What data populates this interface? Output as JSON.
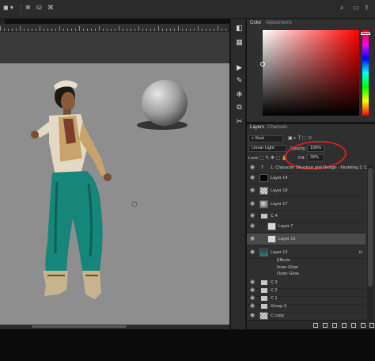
{
  "options_bar": {
    "icons": [
      "brush-size-icon",
      "gear-icon",
      "brush-settings-icon",
      "blend-icon"
    ]
  },
  "color_panel": {
    "tabs": [
      "Color",
      "Adjustments"
    ],
    "accent": "#ff0000"
  },
  "layers_panel": {
    "tabs": [
      "Layers",
      "Channels"
    ],
    "kind_label": "Kind",
    "blend_mode": "Linear Light",
    "opacity_label": "Opacity:",
    "opacity_value": "100%",
    "lock_label": "Lock:",
    "fill_label": "Fill:",
    "fill_value": "39%",
    "layers": [
      {
        "name": "1. Character Structure and Design - Modeling 3. C",
        "type": "text"
      },
      {
        "name": "Layer 14",
        "type": "black"
      },
      {
        "name": "Layer 18",
        "type": "checker"
      },
      {
        "name": "Layer 17",
        "type": "sphere"
      },
      {
        "name": "C 4",
        "type": "group"
      },
      {
        "name": "Layer 7",
        "type": "small"
      },
      {
        "name": "Layer 15",
        "type": "selected"
      },
      {
        "name": "Layer 13",
        "type": "figure"
      },
      {
        "name": "Effects",
        "type": "effect"
      },
      {
        "name": "Inner Glow",
        "type": "effect"
      },
      {
        "name": "Outer Glow",
        "type": "effect"
      },
      {
        "name": "C 3",
        "type": "group"
      },
      {
        "name": "C 2",
        "type": "group"
      },
      {
        "name": "C 1",
        "type": "group"
      },
      {
        "name": "Group 3",
        "type": "group"
      },
      {
        "name": "C copy",
        "type": "checker"
      }
    ]
  },
  "annotation_color": "#d81d1d"
}
